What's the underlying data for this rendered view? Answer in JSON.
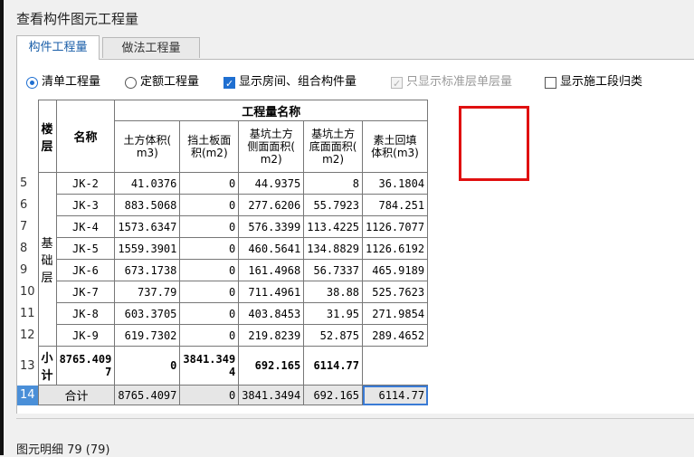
{
  "window": {
    "title": "查看构件图元工程量"
  },
  "tabs": [
    {
      "label": "构件工程量",
      "active": true
    },
    {
      "label": "做法工程量",
      "active": false
    }
  ],
  "options": {
    "radio_list": "清单工程量",
    "radio_quota": "定额工程量",
    "check_rooms": "显示房间、组合构件量",
    "check_std_floor": "只显示标准层单层量",
    "check_stage": "显示施工段归类"
  },
  "table": {
    "group_header": "工程量名称",
    "col_floor": "楼层",
    "col_name": "名称",
    "col_earth": "土方体积(m3)",
    "col_earth_l1": "土方体积(",
    "col_earth_l2": "m3)",
    "col_board_l1": "挡土板面",
    "col_board_l2": "积(m2)",
    "col_side_l1": "基坑土方",
    "col_side_l2": "侧面面积(",
    "col_side_l3": "m2)",
    "col_bottom_l1": "基坑土方",
    "col_bottom_l2": "底面面积(",
    "col_bottom_l3": "m2)",
    "col_backfill_l1": "素土回填",
    "col_backfill_l2": "体积(m3)",
    "floor_value": "基础层",
    "rows": [
      {
        "rn": "5",
        "name": "JK-2",
        "earth": "41.0376",
        "board": "0",
        "side": "44.9375",
        "bottom": "8",
        "backfill": "36.1804"
      },
      {
        "rn": "6",
        "name": "JK-3",
        "earth": "883.5068",
        "board": "0",
        "side": "277.6206",
        "bottom": "55.7923",
        "backfill": "784.251"
      },
      {
        "rn": "7",
        "name": "JK-4",
        "earth": "1573.6347",
        "board": "0",
        "side": "576.3399",
        "bottom": "113.4225",
        "backfill": "1126.7077"
      },
      {
        "rn": "8",
        "name": "JK-5",
        "earth": "1559.3901",
        "board": "0",
        "side": "460.5641",
        "bottom": "134.8829",
        "backfill": "1126.6192"
      },
      {
        "rn": "9",
        "name": "JK-6",
        "earth": "673.1738",
        "board": "0",
        "side": "161.4968",
        "bottom": "56.7337",
        "backfill": "465.9189"
      },
      {
        "rn": "10",
        "name": "JK-7",
        "earth": "737.79",
        "board": "0",
        "side": "711.4961",
        "bottom": "38.88",
        "backfill": "525.7623"
      },
      {
        "rn": "11",
        "name": "JK-8",
        "earth": "603.3705",
        "board": "0",
        "side": "403.8453",
        "bottom": "31.95",
        "backfill": "271.9854"
      },
      {
        "rn": "12",
        "name": "JK-9",
        "earth": "619.7302",
        "board": "0",
        "side": "219.8239",
        "bottom": "52.875",
        "backfill": "289.4652"
      }
    ],
    "subtotal": {
      "rn": "13",
      "name": "小计",
      "earth_a": "8765.409",
      "earth_b": "7",
      "board": "0",
      "side_a": "3841.349",
      "side_b": "4",
      "bottom": "692.165",
      "backfill": "6114.77"
    },
    "total": {
      "rn": "14",
      "label": "合计",
      "earth": "8765.4097",
      "board": "0",
      "side": "3841.3494",
      "bottom": "692.165",
      "backfill": "6114.77"
    }
  },
  "footer": {
    "text": "图元明细  79 (79)"
  },
  "colors": {
    "highlight_box": "#e01010",
    "accent": "#1f6fd1",
    "selection_row": "#4a8fd8"
  }
}
